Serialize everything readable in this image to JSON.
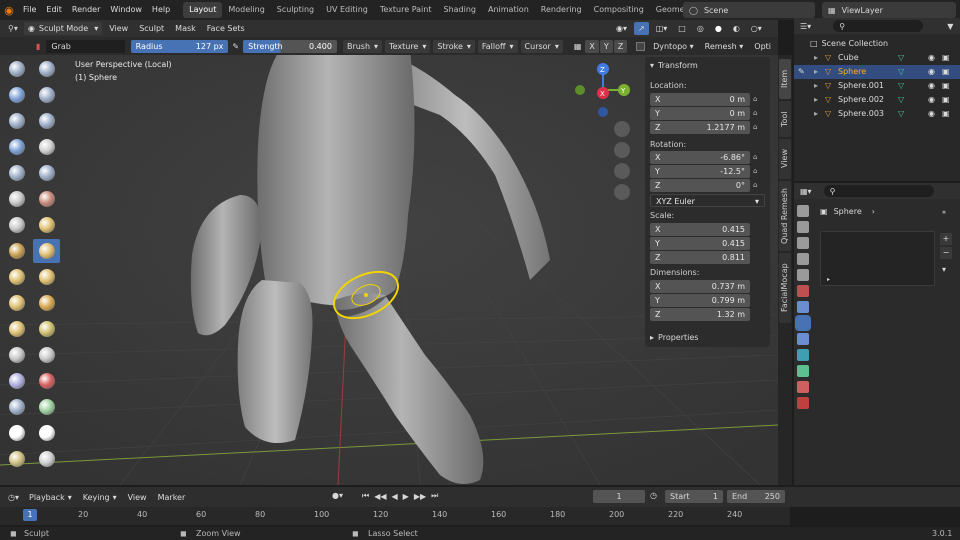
{
  "topbar": {
    "menus": [
      "File",
      "Edit",
      "Render",
      "Window",
      "Help"
    ],
    "workspaces": [
      "Layout",
      "Modeling",
      "Sculpting",
      "UV Editing",
      "Texture Paint",
      "Shading",
      "Animation",
      "Rendering",
      "Compositing",
      "Geome"
    ],
    "active_workspace": "Layout",
    "scene_label": "Scene",
    "viewlayer_label": "ViewLayer"
  },
  "header": {
    "mode_label": "Sculpt Mode",
    "menus": [
      "View",
      "Sculpt",
      "Mask",
      "Face Sets"
    ]
  },
  "tool_settings": {
    "brush_name": "Grab",
    "radius_label": "Radius",
    "radius_value": "127 px",
    "strength_label": "Strength",
    "strength_value": "0.400",
    "dropdowns": [
      "Brush",
      "Texture",
      "Stroke",
      "Falloff",
      "Cursor"
    ],
    "axes": [
      "X",
      "Y",
      "Z"
    ],
    "dyntopo_label": "Dyntopo",
    "remesh_label": "Remesh",
    "options_label": "Opti"
  },
  "viewport": {
    "perspective_label": "User Perspective (Local)",
    "object_label": "(1) Sphere",
    "gizmo_x": "X",
    "gizmo_y": "Y",
    "gizmo_z": "Z"
  },
  "npanel": {
    "section_title": "Transform",
    "location_label": "Location:",
    "location": [
      {
        "axis": "X",
        "value": "0 m"
      },
      {
        "axis": "Y",
        "value": "0 m"
      },
      {
        "axis": "Z",
        "value": "1.2177 m"
      }
    ],
    "rotation_label": "Rotation:",
    "rotation": [
      {
        "axis": "X",
        "value": "-6.86°"
      },
      {
        "axis": "Y",
        "value": "-12.5°"
      },
      {
        "axis": "Z",
        "value": "0°"
      }
    ],
    "rotation_mode": "XYZ Euler",
    "scale_label": "Scale:",
    "scale": [
      {
        "axis": "X",
        "value": "0.415"
      },
      {
        "axis": "Y",
        "value": "0.415"
      },
      {
        "axis": "Z",
        "value": "0.811"
      }
    ],
    "dimensions_label": "Dimensions:",
    "dimensions": [
      {
        "axis": "X",
        "value": "0.737 m"
      },
      {
        "axis": "Y",
        "value": "0.799 m"
      },
      {
        "axis": "Z",
        "value": "1.32 m"
      }
    ],
    "properties_label": "Properties"
  },
  "side_tabs": [
    "Item",
    "Tool",
    "View",
    "Quad Remesh",
    "FacialMocap"
  ],
  "outliner": {
    "collection": "Scene Collection",
    "objects": [
      "Cube",
      "Sphere",
      "Sphere.001",
      "Sphere.002",
      "Sphere.003"
    ],
    "selected": "Sphere"
  },
  "properties": {
    "object_name": "Sphere"
  },
  "timeline": {
    "menus": [
      "Playback",
      "Keying",
      "View",
      "Marker"
    ],
    "current_frame": "1",
    "start_label": "Start",
    "start_value": "1",
    "end_label": "End",
    "end_value": "250",
    "ruler_current": "1",
    "ruler_ticks": [
      "20",
      "40",
      "60",
      "80",
      "100",
      "120",
      "140",
      "160",
      "180",
      "200",
      "220",
      "240"
    ]
  },
  "status": {
    "left_hint": "Sculpt",
    "mid_hint": "Zoom View",
    "right_hint": "Lasso Select",
    "version": "3.0.1"
  },
  "colors": {
    "accent_blue": "#4772b3",
    "selected_row": "#334d80",
    "brush_circle": "#f2d400",
    "mesh_gray": "#9a9a9a"
  }
}
